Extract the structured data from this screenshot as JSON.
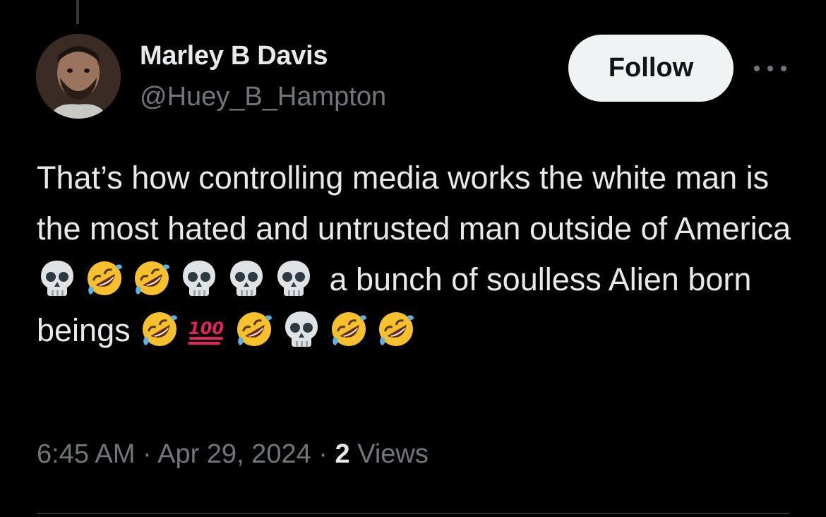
{
  "tweet": {
    "author": {
      "display_name": "Marley B Davis",
      "handle": "@Huey_B_Hampton"
    },
    "follow_label": "Follow",
    "more_icon": "more-horizontal-icon",
    "text": {
      "part1": "That’s how controlling media works the white man is the most hated and untrusted man outside of America ",
      "emojis1": [
        "skull",
        "rofl",
        "rofl",
        "skull",
        "skull",
        "skull"
      ],
      "part2": " a bunch of soulless Alien born beings ",
      "emojis2": [
        "rofl",
        "hundred",
        "rofl",
        "skull",
        "rofl",
        "rofl"
      ]
    },
    "meta": {
      "time": "6:45 AM",
      "sep1": " · ",
      "date": "Apr 29, 2024",
      "sep2": " · ",
      "views_count": "2",
      "views_label": " Views"
    }
  },
  "colors": {
    "background": "#000000",
    "text": "#e7e9ea",
    "secondary": "#71767b",
    "follow_bg": "#eff3f4",
    "divider": "#2f3336"
  }
}
